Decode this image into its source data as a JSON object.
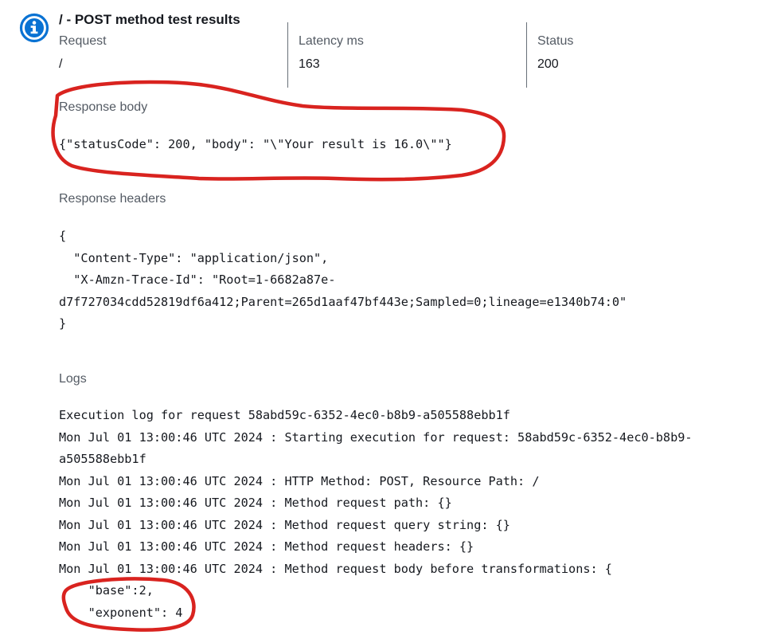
{
  "header": {
    "title": "/ - POST method test results",
    "icon": "info-icon",
    "accent_color": "#0972d3"
  },
  "summary": {
    "request": {
      "label": "Request",
      "value": "/"
    },
    "latency": {
      "label": "Latency ms",
      "value": "163"
    },
    "status": {
      "label": "Status",
      "value": "200"
    }
  },
  "response_body": {
    "label": "Response body",
    "content": "{\"statusCode\": 200, \"body\": \"\\\"Your result is 16.0\\\"\"}"
  },
  "response_headers": {
    "label": "Response headers",
    "lines": [
      "{",
      "  \"Content-Type\": \"application/json\",",
      "  \"X-Amzn-Trace-Id\": \"Root=1-6682a87e-",
      "d7f727034cdd52819df6a412;Parent=265d1aaf47bf443e;Sampled=0;lineage=e1340b74:0\"",
      "}"
    ]
  },
  "logs": {
    "label": "Logs",
    "lines": [
      "Execution log for request 58abd59c-6352-4ec0-b8b9-a505588ebb1f",
      "Mon Jul 01 13:00:46 UTC 2024 : Starting execution for request: 58abd59c-6352-4ec0-b8b9-",
      "a505588ebb1f",
      "Mon Jul 01 13:00:46 UTC 2024 : HTTP Method: POST, Resource Path: /",
      "Mon Jul 01 13:00:46 UTC 2024 : Method request path: {}",
      "Mon Jul 01 13:00:46 UTC 2024 : Method request query string: {}",
      "Mon Jul 01 13:00:46 UTC 2024 : Method request headers: {}",
      "Mon Jul 01 13:00:46 UTC 2024 : Method request body before transformations: {",
      "    \"base\":2,",
      "    \"exponent\": 4"
    ]
  },
  "annotation_color": "#d9231f"
}
